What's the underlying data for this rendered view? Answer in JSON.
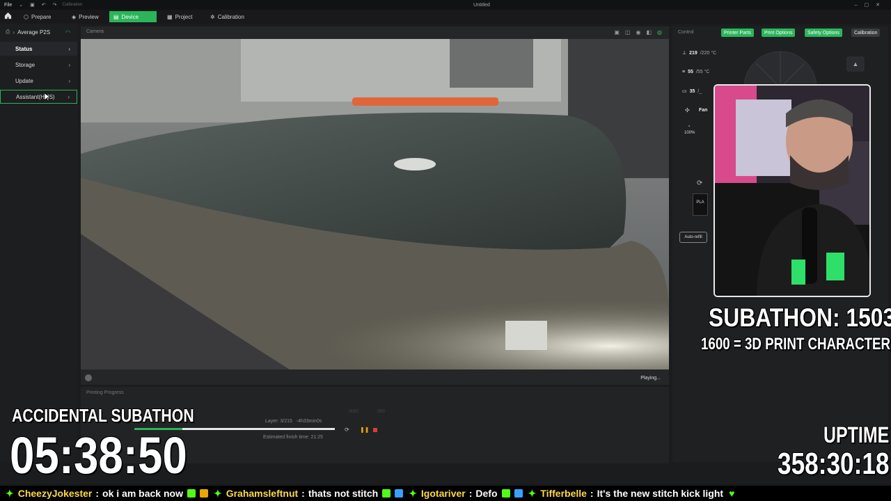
{
  "titlebar": {
    "file_menu": "File",
    "calibration_hint": "Calibration",
    "document_title": "Untitled"
  },
  "nav": {
    "tabs": [
      {
        "label": "Prepare",
        "icon": "prepare-icon"
      },
      {
        "label": "Preview",
        "icon": "preview-icon"
      },
      {
        "label": "Device",
        "icon": "device-icon",
        "active": true
      },
      {
        "label": "Project",
        "icon": "project-icon"
      },
      {
        "label": "Calibration",
        "icon": "calibration-icon"
      }
    ]
  },
  "sidebar": {
    "device_name": "Average P2S",
    "items": [
      {
        "label": "Status",
        "selected": true
      },
      {
        "label": "Storage"
      },
      {
        "label": "Update"
      },
      {
        "label": "Assistant(HMS)"
      }
    ]
  },
  "camera": {
    "label": "Camera",
    "status": "Playing..."
  },
  "progress": {
    "label": "Printing Progress",
    "layer": "Layer: 3/215",
    "remaining": "-4h33min0s",
    "estimated_finish": "Estimated finish time: 21:25",
    "fraction": 0.24
  },
  "control": {
    "label": "Control",
    "tabs": [
      "Printer Parts",
      "Print Options",
      "Safety Options",
      "Calibration"
    ],
    "nozzle_temp": "219",
    "nozzle_target": "/220 °C",
    "bed_temp": "55",
    "bed_target": "/55 °C",
    "chamber_temp": "35",
    "chamber_target": "/_",
    "fan_label": "Fan",
    "fan_percent": "100%",
    "filament": "PLA",
    "auto_refill": "Auto-refill"
  },
  "overlay": {
    "subathon_count": "SUBATHON: 1503",
    "subathon_goal": "1600 = 3D PRINT CHARACTER",
    "accidental_title": "ACCIDENTAL SUBATHON",
    "accidental_timer": "05:38:50",
    "uptime_label": "UPTIME",
    "uptime_value": "358:30:18"
  },
  "chat": [
    {
      "name": "CheezyJokester",
      "message": "ok i am back now"
    },
    {
      "name": "Grahamsleftnut",
      "message": "thats not stitch"
    },
    {
      "name": "Igotariver",
      "message": "Defo"
    },
    {
      "name": "Tifferbelle",
      "message": "It's the new stitch kick light"
    }
  ],
  "colors": {
    "accent": "#2bb55b",
    "chat_name": "#ffd94a"
  }
}
